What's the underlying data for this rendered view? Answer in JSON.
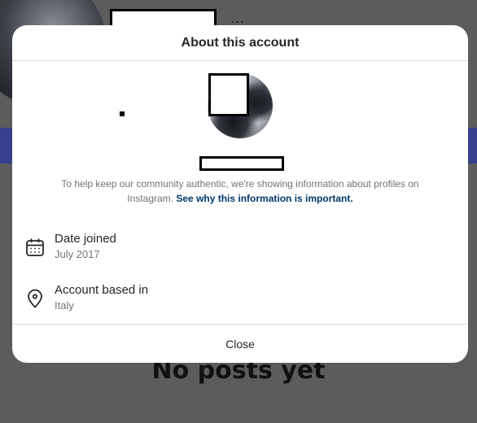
{
  "background": {
    "more_dots": "...",
    "no_posts_text": "No posts yet",
    "accent_band_color": "#37408a"
  },
  "modal": {
    "title": "About this account",
    "info_text": "To help keep our community authentic, we're showing information about profiles on Instagram.",
    "info_link": "See why this information is important.",
    "rows": [
      {
        "icon": "calendar-icon",
        "label": "Date joined",
        "value": "July 2017"
      },
      {
        "icon": "location-pin-icon",
        "label": "Account based in",
        "value": "Italy"
      }
    ],
    "close_label": "Close"
  },
  "colors": {
    "link": "#00376b",
    "secondary_text": "#737373",
    "primary_text": "#262626",
    "divider": "#dbdbdb"
  }
}
